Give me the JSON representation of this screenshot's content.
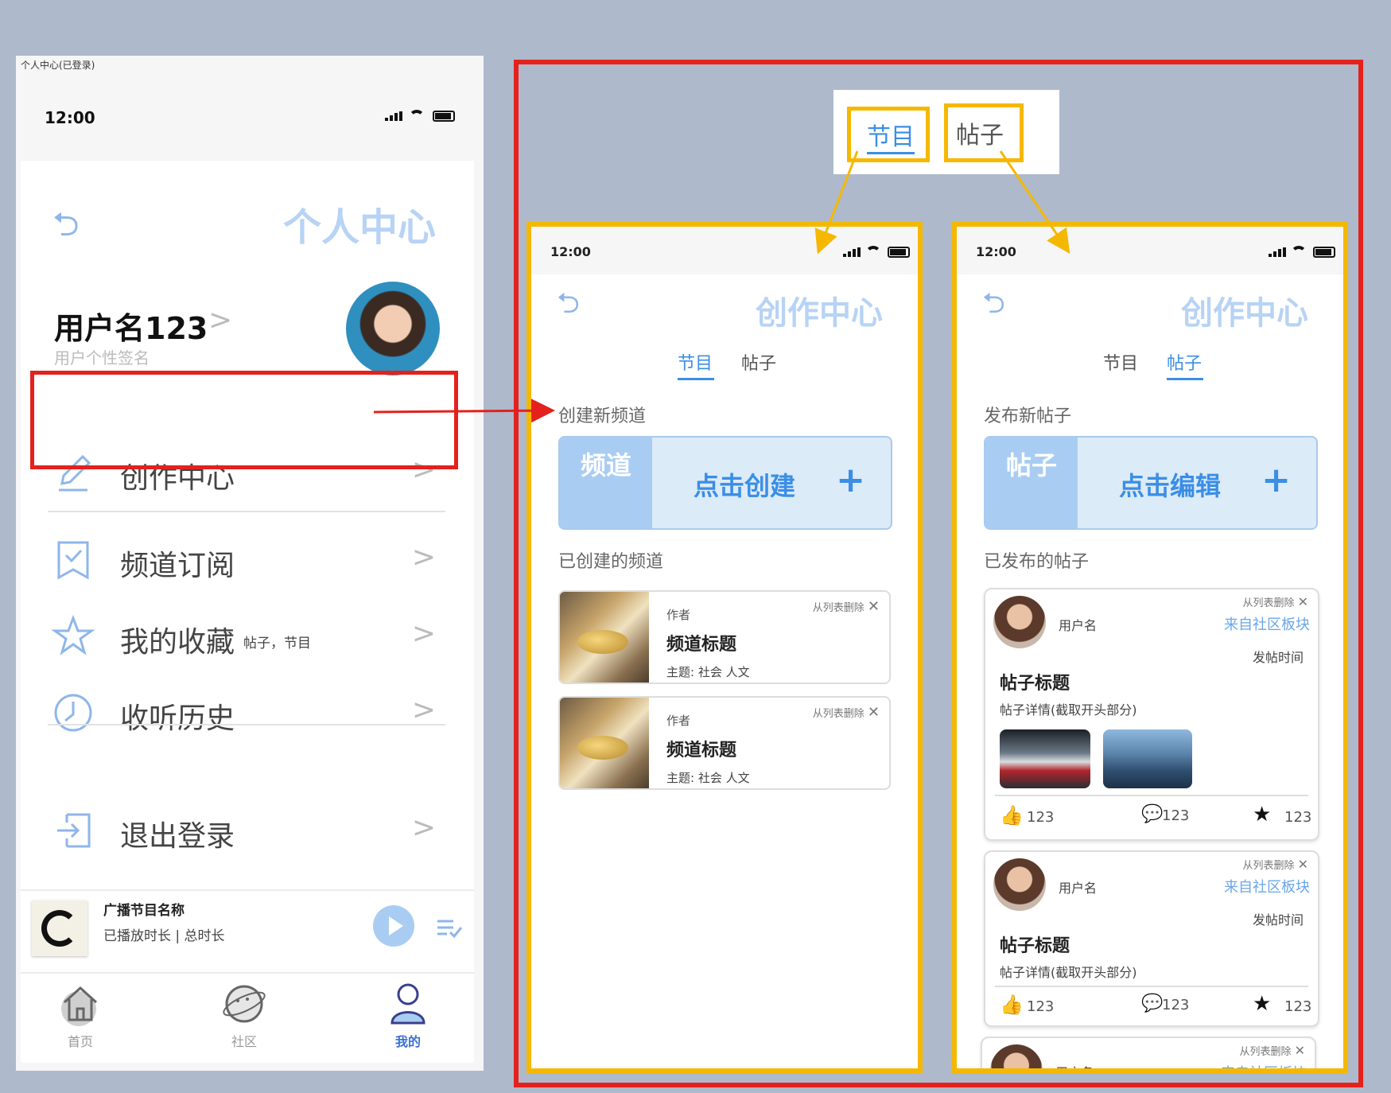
{
  "left_phone": {
    "frame_label": "个人中心(已登录)",
    "status_time": "12:00",
    "page_title": "个人中心",
    "username": "用户名123",
    "signature": "用户个性签名",
    "menu": [
      {
        "label": "创作中心",
        "icon": "pencil-icon"
      },
      {
        "label": "频道订阅",
        "icon": "bookmark-check-icon"
      },
      {
        "label": "我的收藏",
        "icon": "star-icon",
        "sub": "帖子，节目"
      },
      {
        "label": "收听历史",
        "icon": "clock-icon"
      },
      {
        "label": "退出登录",
        "icon": "logout-icon"
      }
    ],
    "arrow": ">",
    "player": {
      "title": "广播节目名称",
      "subtitle": "已播放时长 | 总时长"
    },
    "nav": [
      {
        "label": "首页",
        "icon": "home-icon"
      },
      {
        "label": "社区",
        "icon": "planet-icon"
      },
      {
        "label": "我的",
        "icon": "profile-icon",
        "active": true
      }
    ]
  },
  "top_tabs": {
    "tab1": "节目",
    "tab2": "帖子"
  },
  "creation_programs": {
    "status_time": "12:00",
    "title": "创作中心",
    "tabs": [
      "节目",
      "帖子"
    ],
    "active_tab": "节目",
    "create_section": "创建新频道",
    "side_label": "频道",
    "action": "点击创建",
    "plus": "+",
    "list_section": "已创建的频道",
    "channels": [
      {
        "author": "作者",
        "title": "频道标题",
        "topic": "主题: 社会 人文",
        "delete": "从列表删除"
      },
      {
        "author": "作者",
        "title": "频道标题",
        "topic": "主题: 社会 人文",
        "delete": "从列表删除"
      }
    ]
  },
  "creation_posts": {
    "status_time": "12:00",
    "title": "创作中心",
    "tabs": [
      "节目",
      "帖子"
    ],
    "active_tab": "帖子",
    "create_section": "发布新帖子",
    "side_label": "帖子",
    "action": "点击编辑",
    "plus": "+",
    "list_section": "已发布的帖子",
    "posts": [
      {
        "user": "用户名",
        "delete": "从列表删除",
        "from": "来自社区板块",
        "time": "发帖时间",
        "title": "帖子标题",
        "detail": "帖子详情(截取开头部分)",
        "likes": "123",
        "comments": "123",
        "stars": "123"
      },
      {
        "user": "用户名",
        "delete": "从列表删除",
        "from": "来自社区板块",
        "time": "发帖时间",
        "title": "帖子标题",
        "detail": "帖子详情(截取开头部分)",
        "likes": "123",
        "comments": "123",
        "stars": "123"
      },
      {
        "user": "用户名",
        "delete": "从列表删除",
        "from": "来自社区板块"
      }
    ]
  },
  "colors": {
    "accent": "#3a8ee6",
    "highlight_red": "#e4211c",
    "highlight_yellow": "#f5b800",
    "background": "#aeb9cb"
  }
}
